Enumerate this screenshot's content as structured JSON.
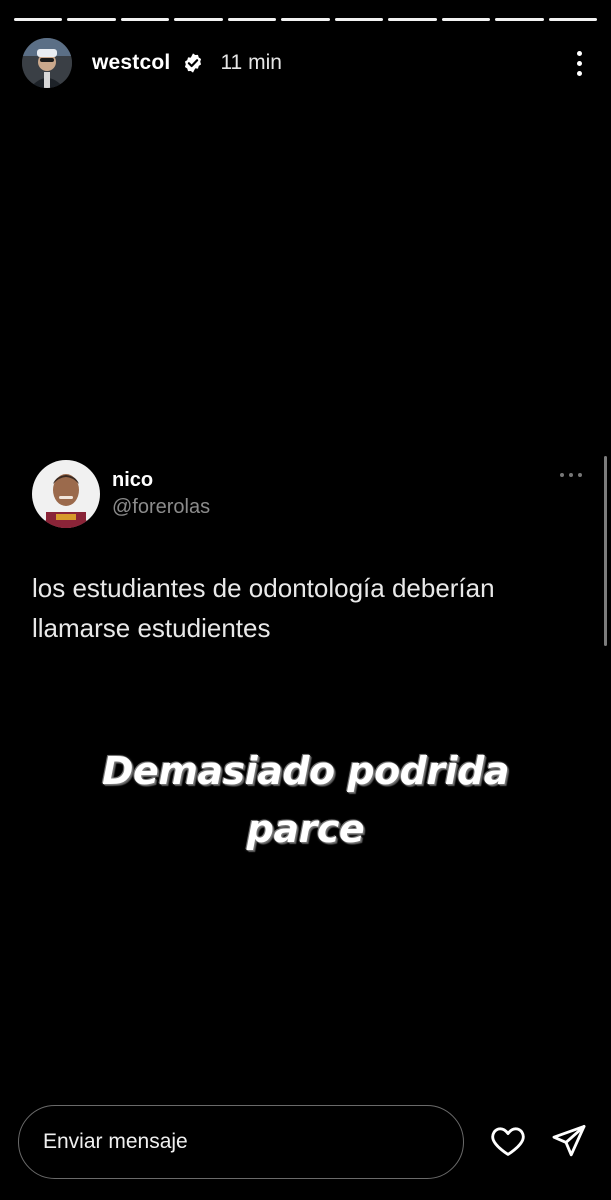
{
  "story": {
    "progress_segments": 11,
    "author": {
      "username": "westcol",
      "verified": true,
      "time_ago": "11 min",
      "avatar_icon": "profile-avatar"
    },
    "menu_icon": "more-vertical-icon"
  },
  "tweet": {
    "name": "nico",
    "handle": "@forerolas",
    "text": "los estudiantes de odontología deberían llamarse estudientes",
    "menu_icon": "more-horizontal-icon"
  },
  "caption": {
    "line1": "Demasiado podrida",
    "line2": "parce"
  },
  "footer": {
    "message_placeholder": "Enviar mensaje",
    "like_icon": "heart-icon",
    "share_icon": "send-icon"
  },
  "colors": {
    "background": "#000000",
    "text": "#ffffff",
    "muted": "#8b8b8b"
  }
}
